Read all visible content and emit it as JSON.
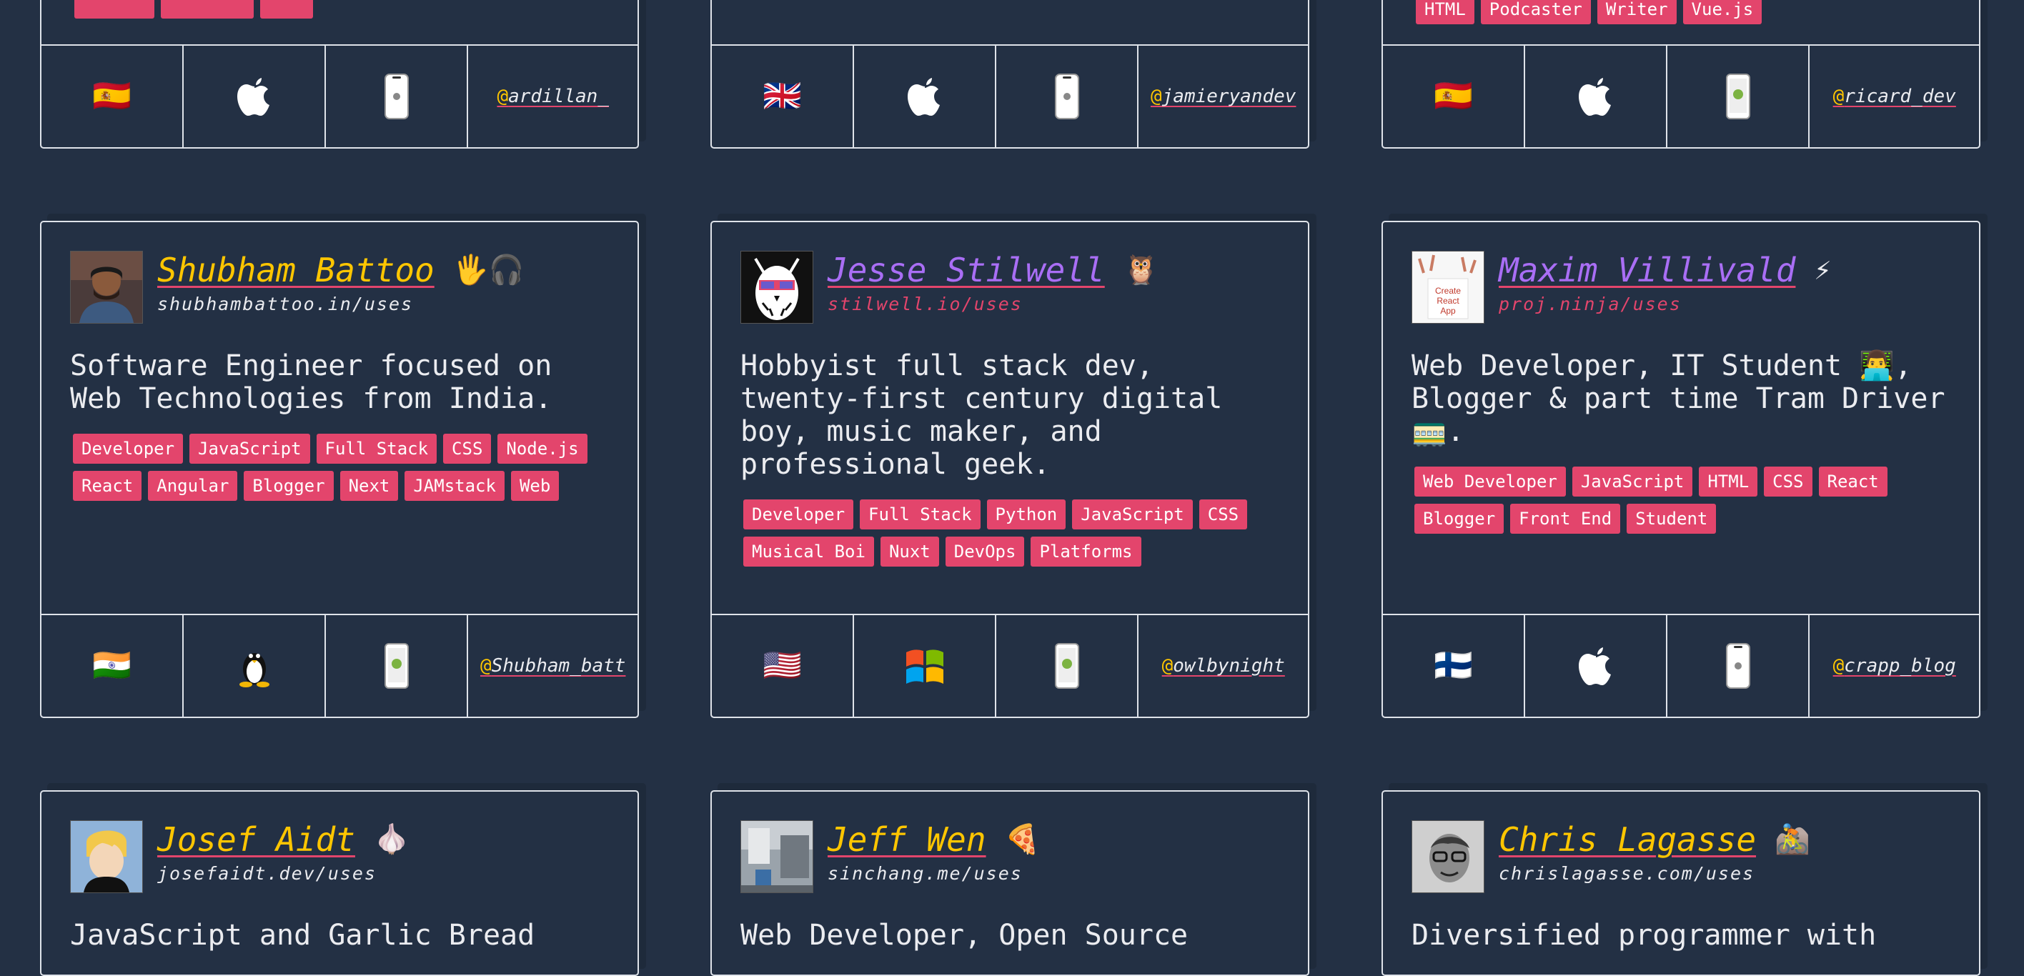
{
  "colors": {
    "background": "#233044",
    "accent_pink": "#e3456c",
    "accent_yellow": "#ffc600",
    "accent_purple": "#a96ef5",
    "border": "#dfe3ea"
  },
  "top_row": [
    {
      "flag": "🇪🇸",
      "os": "apple-icon",
      "device": "iphone-icon",
      "handle": "ardillan_",
      "tags": [
        "",
        "",
        ""
      ]
    },
    {
      "flag": "🇬🇧",
      "os": "apple-icon",
      "device": "iphone-icon",
      "handle": "jamieryandev",
      "tags": []
    },
    {
      "flag": "🇪🇸",
      "os": "apple-icon",
      "device": "android-phone-icon",
      "handle": "ricard_dev",
      "tags": [
        "HTML",
        "Podcaster",
        "Writer",
        "Vue.js"
      ]
    }
  ],
  "cards": [
    {
      "name": "Shubham Battoo",
      "emoji": "🖐🎧",
      "url": "shubhambattoo.in/uses",
      "bio": "Software Engineer focused on\nWeb Technologies from India.",
      "tags": [
        "Developer",
        "JavaScript",
        "Full Stack",
        "CSS",
        "Node.js",
        "React",
        "Angular",
        "Blogger",
        "Next",
        "JAMstack",
        "Web"
      ],
      "flag": "🇮🇳",
      "os": "linux-icon",
      "device": "android-phone-icon",
      "handle": "Shubham_batt"
    },
    {
      "name": "Jesse Stilwell",
      "emoji": "🦉",
      "url": "stilwell.io/uses",
      "bio": "Hobbyist full stack dev,\ntwenty-first century digital\nboy, music maker, and\nprofessional geek.",
      "tags": [
        "Developer",
        "Full Stack",
        "Python",
        "JavaScript",
        "CSS",
        "Musical Boi",
        "Nuxt",
        "DevOps",
        "Platforms"
      ],
      "flag": "🇺🇸",
      "os": "windows-icon",
      "device": "android-phone-icon",
      "handle": "owlbynight"
    },
    {
      "name": "Maxim Villivald",
      "emoji": "⚡",
      "url": "proj.ninja/uses",
      "bio": "Web Developer, IT Student 👨‍💻,\nBlogger & part time Tram Driver\n🚃.",
      "tags": [
        "Web Developer",
        "JavaScript",
        "HTML",
        "CSS",
        "React",
        "Blogger",
        "Front End",
        "Student"
      ],
      "flag": "🇫🇮",
      "os": "apple-icon",
      "device": "iphone-icon",
      "handle": "crapp_blog",
      "avatar_text": "Create React App"
    }
  ],
  "bottom_row": [
    {
      "name": "Josef Aidt",
      "emoji": "🧄",
      "url": "josefaidt.dev/uses",
      "bio": "JavaScript and Garlic Bread"
    },
    {
      "name": "Jeff Wen",
      "emoji": "🍕",
      "url": "sinchang.me/uses",
      "bio": "Web Developer, Open Source"
    },
    {
      "name": "Chris Lagasse",
      "emoji": "🚵",
      "url": "chrislagasse.com/uses",
      "bio": "Diversified programmer with"
    }
  ]
}
